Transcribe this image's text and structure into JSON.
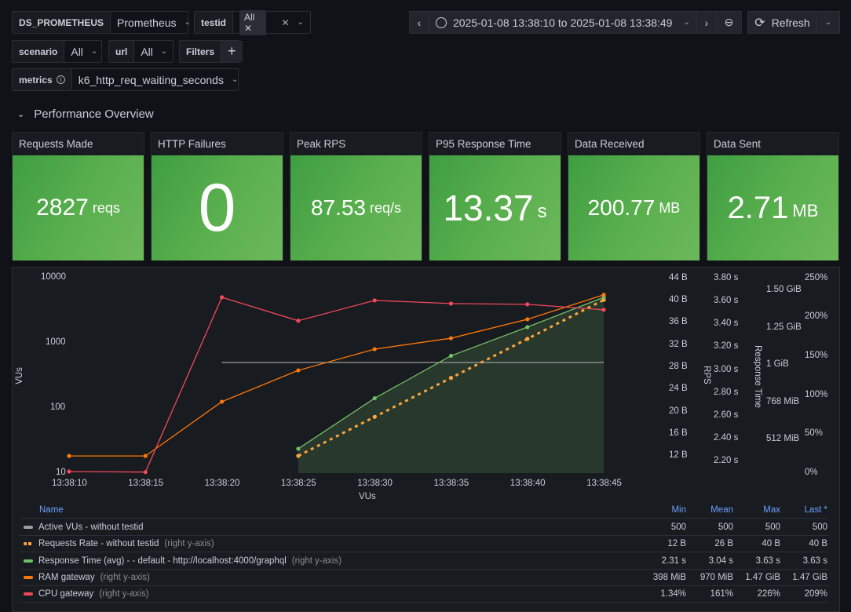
{
  "vars": {
    "datasource": {
      "label": "DS_PROMETHEUS",
      "value": "Prometheus"
    },
    "testid": {
      "label": "testid",
      "chip": "All"
    },
    "scenario": {
      "label": "scenario",
      "value": "All"
    },
    "url": {
      "label": "url",
      "value": "All"
    },
    "filters": {
      "label": "Filters",
      "add": "+"
    },
    "metrics": {
      "label": "metrics",
      "value": "k6_http_req_waiting_seconds"
    }
  },
  "toolbar": {
    "time_range": "2025-01-08 13:38:10 to 2025-01-08 13:38:49",
    "refresh": "Refresh"
  },
  "row": {
    "title": "Performance Overview"
  },
  "stats": [
    {
      "title": "Requests Made",
      "value": "2827",
      "unit": "reqs"
    },
    {
      "title": "HTTP Failures",
      "value": "0",
      "unit": ""
    },
    {
      "title": "Peak RPS",
      "value": "87.53",
      "unit": "req/s"
    },
    {
      "title": "P95 Response Time",
      "value": "13.37",
      "unit": "s"
    },
    {
      "title": "Data Received",
      "value": "200.77",
      "unit": "MB"
    },
    {
      "title": "Data Sent",
      "value": "2.71",
      "unit": "MB"
    }
  ],
  "chart_data": {
    "type": "line",
    "x": [
      "13:38:10",
      "13:38:15",
      "13:38:20",
      "13:38:25",
      "13:38:30",
      "13:38:35",
      "13:38:40",
      "13:38:45"
    ],
    "xlabel": "VUs",
    "axes": {
      "left": {
        "label": "VUs",
        "scale": "log",
        "ticks": [
          "10000",
          "1000",
          "100",
          "10"
        ]
      },
      "rps": {
        "label": "RPS",
        "ticks": [
          "44 B",
          "40 B",
          "36 B",
          "32 B",
          "28 B",
          "24 B",
          "20 B",
          "16 B",
          "12 B"
        ],
        "range": [
          12,
          44
        ]
      },
      "rt": {
        "label": "Response Time",
        "ticks": [
          "3.80 s",
          "3.60 s",
          "3.40 s",
          "3.20 s",
          "3.00 s",
          "2.80 s",
          "2.60 s",
          "2.40 s",
          "2.20 s"
        ],
        "range": [
          2.2,
          3.8
        ]
      },
      "ram": {
        "ticks": [
          "1.50 GiB",
          "1.25 GiB",
          "1 GiB",
          "768 MiB",
          "512 MiB"
        ],
        "range_mib": [
          512,
          1536
        ]
      },
      "cpu": {
        "ticks": [
          "250%",
          "200%",
          "150%",
          "100%",
          "50%",
          "0%"
        ],
        "range": [
          0,
          250
        ]
      }
    },
    "series": [
      {
        "name": "Active VUs - without testid",
        "axis": "left",
        "color": "#9e9e9e",
        "values": [
          null,
          null,
          500,
          500,
          500,
          500,
          500,
          500
        ]
      },
      {
        "name": "Requests Rate - without testid",
        "axis": "rps",
        "color": "#ffa53b",
        "dashed": true,
        "values": [
          null,
          null,
          null,
          12,
          19,
          26,
          33,
          40
        ]
      },
      {
        "name": "Response Time (avg) - - default - http://localhost:4000/graphql",
        "axis": "rt",
        "color": "#73bf69",
        "fill": true,
        "values": [
          null,
          null,
          null,
          2.31,
          2.75,
          3.12,
          3.37,
          3.63
        ]
      },
      {
        "name": "RAM gateway",
        "axis": "ram",
        "color": "#ff780a",
        "values": [
          398,
          398,
          771,
          986,
          1132,
          1207,
          1337,
          1505
        ]
      },
      {
        "name": "CPU gateway",
        "axis": "cpu",
        "color": "#f2495c",
        "values": [
          2,
          1.34,
          225,
          195,
          221,
          217,
          216,
          209
        ]
      }
    ]
  },
  "legend": {
    "headers": {
      "name": "Name",
      "min": "Min",
      "mean": "Mean",
      "max": "Max",
      "last": "Last *"
    },
    "suffix": "(right y-axis)",
    "rows": [
      {
        "name": "Active VUs - without testid",
        "suffix": "",
        "min": "500",
        "mean": "500",
        "max": "500",
        "last": "500"
      },
      {
        "name": "Requests Rate - without testid",
        "suffix": "(right y-axis)",
        "min": "12 B",
        "mean": "26 B",
        "max": "40 B",
        "last": "40 B"
      },
      {
        "name": "Response Time (avg) - - default - http://localhost:4000/graphql",
        "suffix": "(right y-axis)",
        "min": "2.31 s",
        "mean": "3.04 s",
        "max": "3.63 s",
        "last": "3.63 s"
      },
      {
        "name": "RAM gateway",
        "suffix": "(right y-axis)",
        "min": "398 MiB",
        "mean": "970 MiB",
        "max": "1.47 GiB",
        "last": "1.47 GiB"
      },
      {
        "name": "CPU gateway",
        "suffix": "(right y-axis)",
        "min": "1.34%",
        "mean": "161%",
        "max": "226%",
        "last": "209%"
      }
    ]
  }
}
